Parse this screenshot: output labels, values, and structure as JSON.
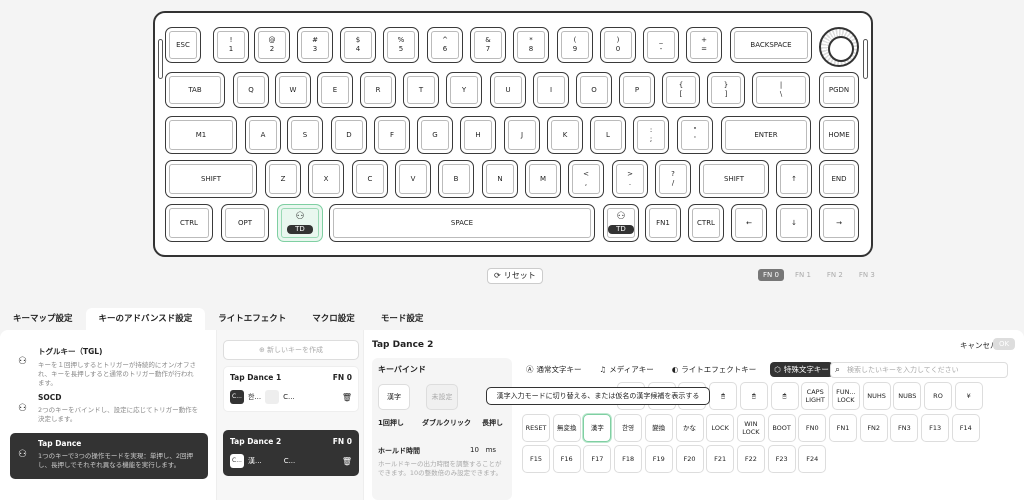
{
  "keyboard": {
    "rows": [
      [
        {
          "l": "ESC"
        },
        {
          "t": "!",
          "b": "1"
        },
        {
          "t": "@",
          "b": "2"
        },
        {
          "t": "#",
          "b": "3"
        },
        {
          "t": "$",
          "b": "4"
        },
        {
          "t": "%",
          "b": "5"
        },
        {
          "t": "^",
          "b": "6"
        },
        {
          "t": "&",
          "b": "7"
        },
        {
          "t": "*",
          "b": "8"
        },
        {
          "t": "(",
          "b": "9"
        },
        {
          "t": ")",
          "b": "0"
        },
        {
          "t": "_",
          "b": "-"
        },
        {
          "t": "+",
          "b": "="
        },
        {
          "l": "BACKSPACE"
        }
      ],
      [
        {
          "l": "TAB"
        },
        {
          "l": "Q"
        },
        {
          "l": "W"
        },
        {
          "l": "E"
        },
        {
          "l": "R"
        },
        {
          "l": "T"
        },
        {
          "l": "Y"
        },
        {
          "l": "U"
        },
        {
          "l": "I"
        },
        {
          "l": "O"
        },
        {
          "l": "P"
        },
        {
          "t": "{",
          "b": "["
        },
        {
          "t": "}",
          "b": "]"
        },
        {
          "t": "|",
          "b": "\\"
        },
        {
          "l": "PGDN"
        }
      ],
      [
        {
          "l": "M1"
        },
        {
          "l": "A"
        },
        {
          "l": "S"
        },
        {
          "l": "D"
        },
        {
          "l": "F"
        },
        {
          "l": "G"
        },
        {
          "l": "H"
        },
        {
          "l": "J"
        },
        {
          "l": "K"
        },
        {
          "l": "L"
        },
        {
          "t": ":",
          "b": ";"
        },
        {
          "t": "\"",
          "b": "'"
        },
        {
          "l": "ENTER"
        },
        {
          "l": "HOME"
        }
      ],
      [
        {
          "l": "SHIFT"
        },
        {
          "l": "Z"
        },
        {
          "l": "X"
        },
        {
          "l": "C"
        },
        {
          "l": "V"
        },
        {
          "l": "B"
        },
        {
          "l": "N"
        },
        {
          "l": "M"
        },
        {
          "t": "<",
          "b": ","
        },
        {
          "t": ">",
          "b": "."
        },
        {
          "t": "?",
          "b": "/"
        },
        {
          "l": "SHIFT"
        },
        {
          "l": "↑"
        },
        {
          "l": "END"
        }
      ],
      [
        {
          "l": "CTRL"
        },
        {
          "l": "OPT"
        },
        {
          "l": "TD",
          "td": true,
          "hl": true
        },
        {
          "l": "SPACE"
        },
        {
          "l": "TD",
          "td": true
        },
        {
          "l": "FN1"
        },
        {
          "l": "CTRL"
        },
        {
          "l": "←"
        },
        {
          "l": "↓"
        },
        {
          "l": "→"
        }
      ]
    ]
  },
  "reset": "リセット",
  "fn": [
    "FN 0",
    "FN 1",
    "FN 2",
    "FN 3"
  ],
  "tabs": [
    "キーマップ設定",
    "キーのアドバンスド設定",
    "ライトエフェクト",
    "マクロ設定",
    "モード設定"
  ],
  "modes": [
    {
      "title": "トグルキー（TGL)",
      "desc": "キーを１回押しするとトリガーが持続的にオン/オフされ、キーを長押しすると通常のトリガー動作が行われます。"
    },
    {
      "title": "SOCD",
      "desc": "2つのキーをバインドし、設定に応じてトリガー動作を決定します。"
    },
    {
      "title": "Tap Dance",
      "desc": "1つのキーで3つの操作モードを実現：単押し、2回押し、長押しでそれぞれ異なる機能を実行します。"
    }
  ],
  "newkey": "新しいキーを作成",
  "td_cards": [
    {
      "name": "Tap Dance 1",
      "fn": "FN 0",
      "k1": "C...",
      "k2": "한...",
      "k3": "C..."
    },
    {
      "name": "Tap Dance 2",
      "fn": "FN 0",
      "k1": "C...",
      "k2": "漢...",
      "k3": "C..."
    }
  ],
  "editor": {
    "title": "Tap Dance 2",
    "cancel": "キャンセル",
    "ok": "OK",
    "keybind": "キーバインド",
    "slots": [
      "漢字",
      "未設定"
    ],
    "slot_labels": [
      "1回押し",
      "ダブルクリック",
      "長押し"
    ],
    "hold_label": "ホールド時間",
    "hold_value": "10",
    "hold_unit": "ms",
    "hold_desc": "ホールドキーの出力時間を調整することができます。10の整数倍のみ設定できます。"
  },
  "cats": [
    "通常文字キー",
    "メディアキー",
    "ライトエフェクトキー",
    "特殊文字キー"
  ],
  "search_ph": "検索したいキーを入力してください",
  "tooltip": "漢字入力モードに切り替える、または仮名の漢字候補を表示する",
  "keys_row1": [
    "",
    "",
    "",
    "",
    "",
    "",
    "CAPS LIGHT",
    "FUN... LOCK",
    "NUHS",
    "NUBS",
    "RO",
    "¥"
  ],
  "keys_row2": [
    "RESET",
    "無変換",
    "漢字",
    "한영",
    "變換",
    "かな",
    "LOCK",
    "WIN LOCK",
    "BOOT",
    "FN0",
    "FN1",
    "FN2",
    "FN3",
    "F13",
    "F14"
  ],
  "keys_row3": [
    "F15",
    "F16",
    "F17",
    "F18",
    "F19",
    "F20",
    "F21",
    "F22",
    "F23",
    "F24"
  ]
}
